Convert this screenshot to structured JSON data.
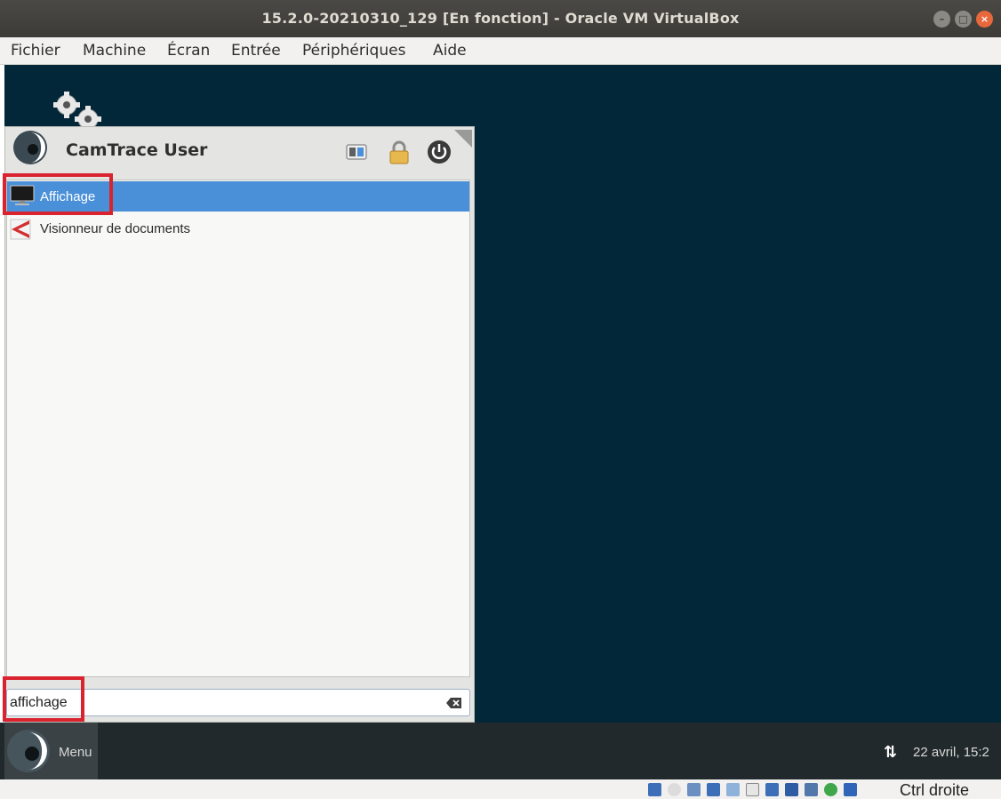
{
  "window": {
    "title": "15.2.0-20210310_129 [En fonction] - Oracle VM VirtualBox",
    "buttons": [
      "minimize",
      "maximize",
      "close"
    ]
  },
  "menubar": {
    "items": [
      "Fichier",
      "Machine",
      "Écran",
      "Entrée",
      "Périphériques",
      "Aide"
    ]
  },
  "whisker_menu": {
    "user_name": "CamTrace User",
    "header_icons": [
      "settings-icon",
      "lock-icon",
      "power-icon"
    ],
    "results": [
      {
        "label": "Affichage",
        "icon": "monitor-icon",
        "selected": true
      },
      {
        "label": "Visionneur de documents",
        "icon": "document-viewer-icon",
        "selected": false
      }
    ],
    "search": {
      "value": "affichage",
      "clear_icon": "backspace-icon"
    }
  },
  "panel": {
    "menu_label": "Menu",
    "network_icon": "⇅",
    "clock": "22 avril, 15:2"
  },
  "statusbar": {
    "host_key": "Ctrl droite",
    "icons": [
      "hard-disk-icon",
      "optical-drive-icon",
      "audio-icon",
      "network-icon",
      "usb-icon",
      "shared-folders-icon",
      "display-icon",
      "recording-icon",
      "cpu-icon",
      "mouse-integration-icon",
      "keyboard-capture-icon"
    ]
  },
  "colors": {
    "desktop": "#022739",
    "selection": "#4a90d9",
    "highlight_box": "#d9232f",
    "panel": "#22292c"
  }
}
